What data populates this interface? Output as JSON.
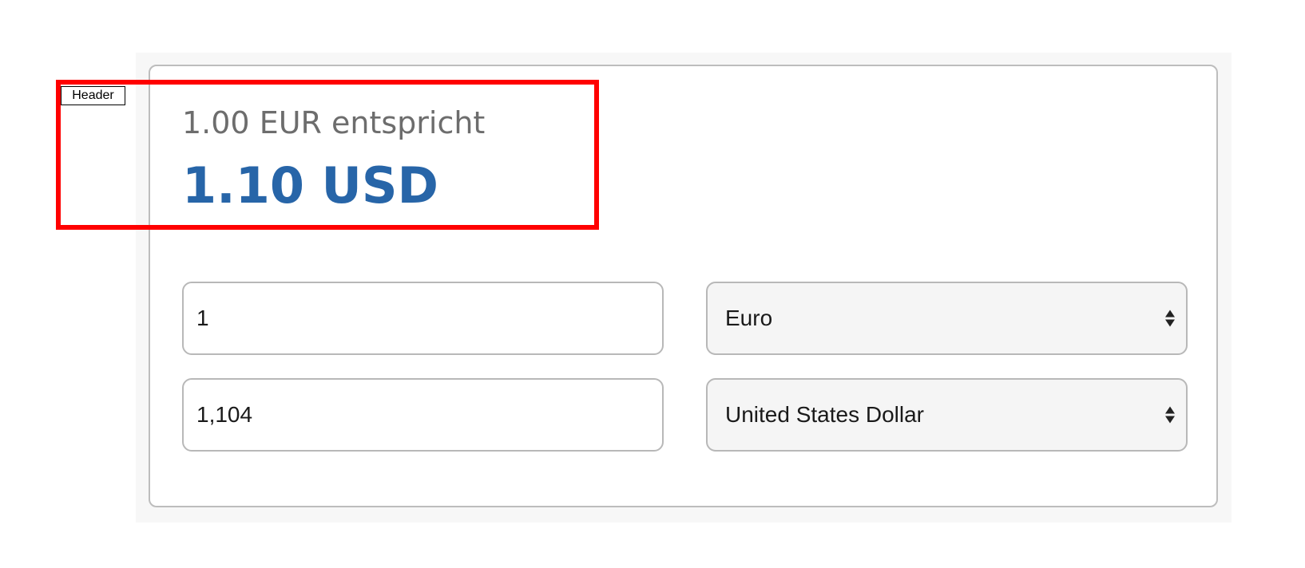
{
  "converter": {
    "subtitle": "1.00 EUR entspricht",
    "result": "1.10 USD",
    "from": {
      "amount": "1",
      "currency": "Euro"
    },
    "to": {
      "amount": "1,104",
      "currency": "United States Dollar"
    }
  },
  "annotation": {
    "label": "Header",
    "color": "#ff0000"
  },
  "colors": {
    "result_text": "#2765a8",
    "subtitle_text": "#6d6d6d"
  }
}
